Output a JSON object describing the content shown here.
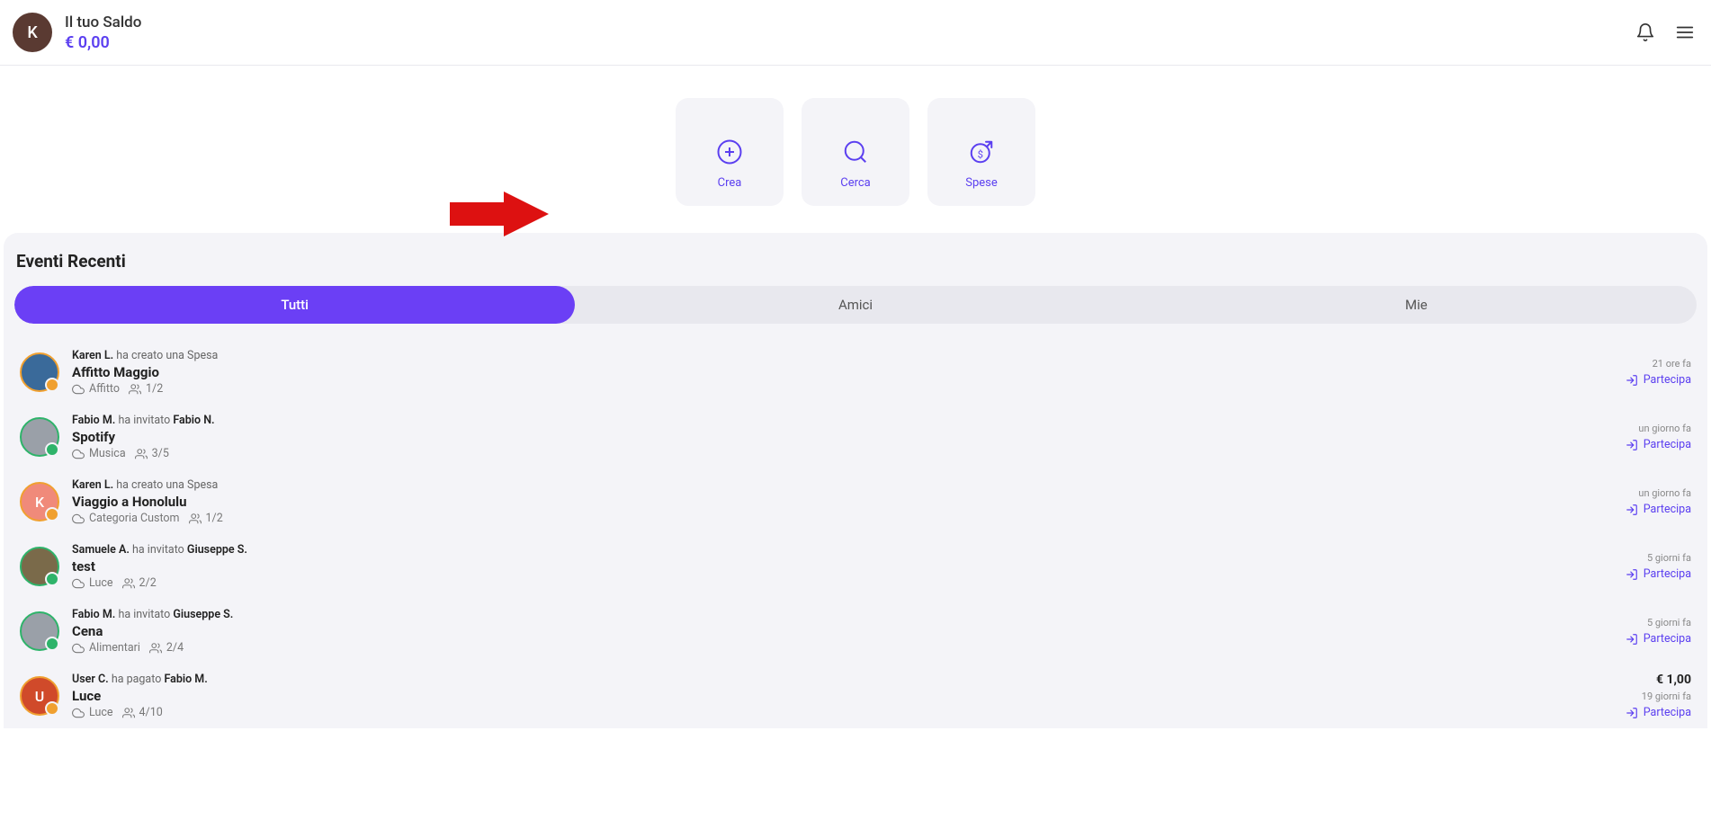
{
  "header": {
    "avatar_letter": "K",
    "balance_label": "Il tuo Saldo",
    "balance_value": "€ 0,00"
  },
  "actions": {
    "create": "Crea",
    "search": "Cerca",
    "expenses": "Spese"
  },
  "section_title": "Eventi Recenti",
  "tabs": {
    "all": "Tutti",
    "friends": "Amici",
    "mine": "Mie"
  },
  "join_label": "Partecipa",
  "events": [
    {
      "actor": "Karen L.",
      "verb": "ha creato una Spesa",
      "target": "",
      "title": "Affitto Maggio",
      "category": "Affitto",
      "count": "1/2",
      "time": "21 ore fa",
      "amount": "",
      "avatar_letter": "",
      "avatar_bg": "#3a6a9a",
      "ring": "orange",
      "badge": "orange"
    },
    {
      "actor": "Fabio M.",
      "verb": "ha invitato",
      "target": "Fabio N.",
      "title": "Spotify",
      "category": "Musica",
      "count": "3/5",
      "time": "un giorno fa",
      "amount": "",
      "avatar_letter": "",
      "avatar_bg": "#9aa0a8",
      "ring": "green",
      "badge": "green"
    },
    {
      "actor": "Karen L.",
      "verb": "ha creato una Spesa",
      "target": "",
      "title": "Viaggio a Honolulu",
      "category": "Categoria Custom",
      "count": "1/2",
      "time": "un giorno fa",
      "amount": "",
      "avatar_letter": "K",
      "avatar_bg": "#f08a7a",
      "ring": "orange",
      "badge": "orange"
    },
    {
      "actor": "Samuele A.",
      "verb": "ha invitato",
      "target": "Giuseppe S.",
      "title": "test",
      "category": "Luce",
      "count": "2/2",
      "time": "5 giorni fa",
      "amount": "",
      "avatar_letter": "",
      "avatar_bg": "#7a6a4a",
      "ring": "green",
      "badge": "green"
    },
    {
      "actor": "Fabio M.",
      "verb": "ha invitato",
      "target": "Giuseppe S.",
      "title": "Cena",
      "category": "Alimentari",
      "count": "2/4",
      "time": "5 giorni fa",
      "amount": "",
      "avatar_letter": "",
      "avatar_bg": "#9aa0a8",
      "ring": "green",
      "badge": "green"
    },
    {
      "actor": "User C.",
      "verb": "ha pagato",
      "target": "Fabio M.",
      "title": "Luce",
      "category": "Luce",
      "count": "4/10",
      "time": "19 giorni fa",
      "amount": "€ 1,00",
      "avatar_letter": "U",
      "avatar_bg": "#d04a2a",
      "ring": "orange",
      "badge": "orange"
    }
  ]
}
